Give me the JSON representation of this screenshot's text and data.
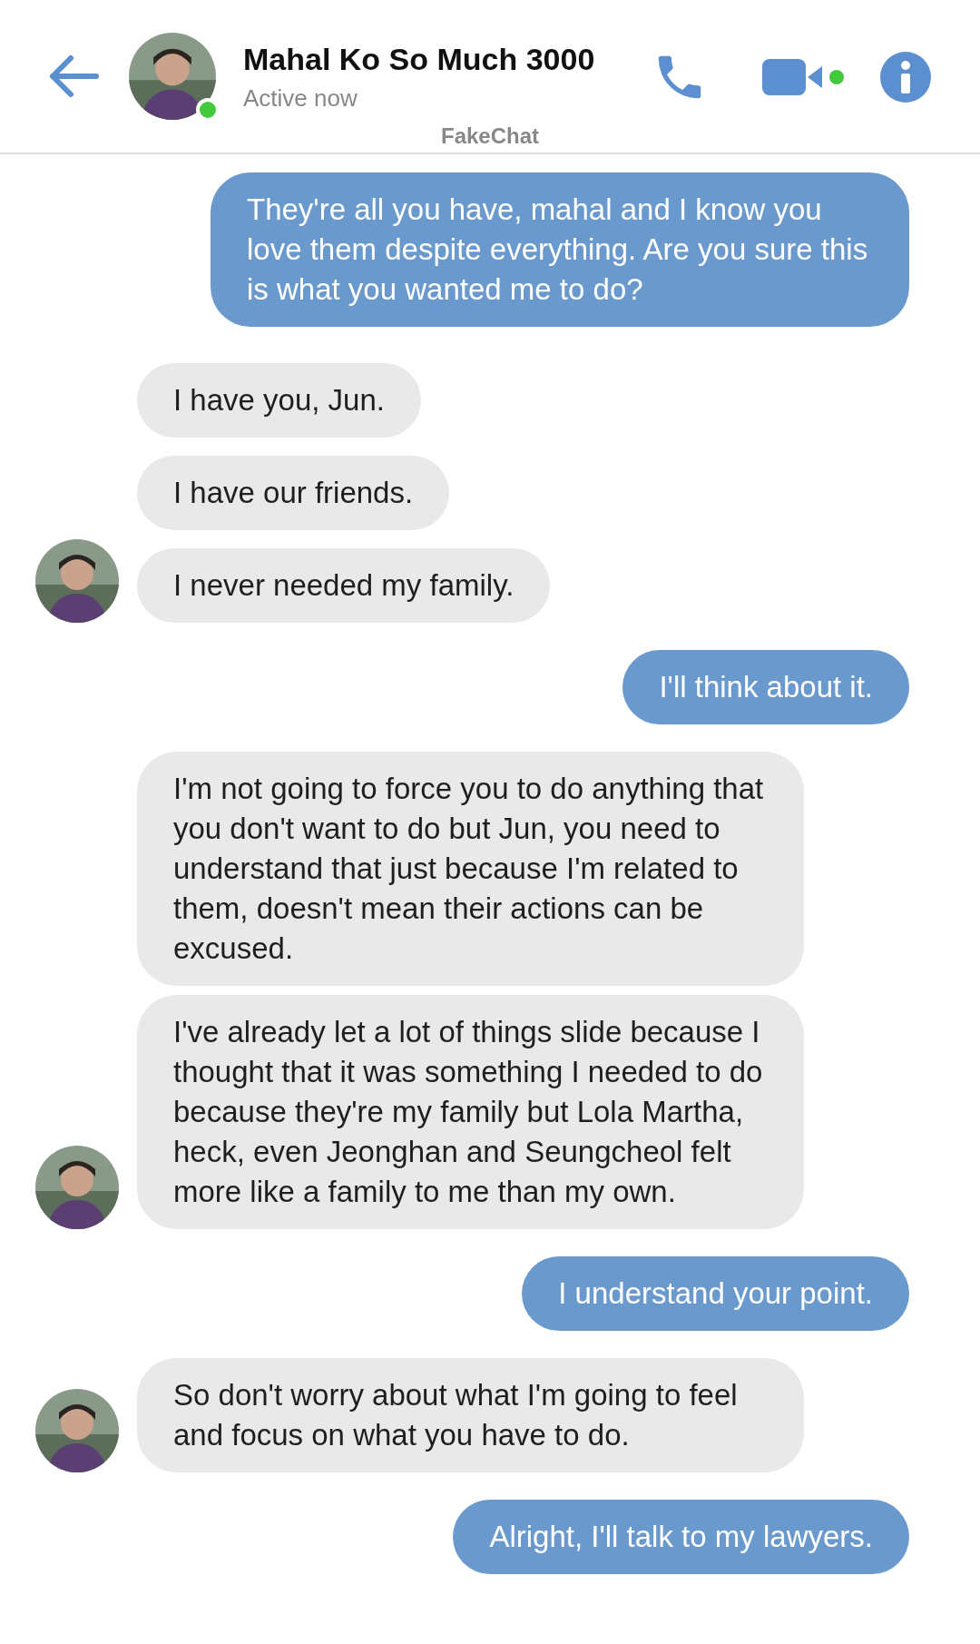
{
  "header": {
    "title": "Mahal Ko So Much 3000",
    "status": "Active now",
    "online": true,
    "app_label": "FakeChat"
  },
  "messages": [
    {
      "kind": "sent",
      "text": "They're all you have, mahal and I know you love them despite everything. Are you sure this is what you wanted me to do?"
    },
    {
      "kind": "received",
      "text": "I have you, Jun."
    },
    {
      "kind": "received",
      "text": "I have our friends."
    },
    {
      "kind": "received",
      "text": "I never needed my family."
    },
    {
      "kind": "sent",
      "text": "I'll think about it."
    },
    {
      "kind": "received",
      "text": "I'm not going to force you to do anything that you don't want to do but Jun, you need to understand that just because I'm related to them, doesn't mean their actions can be excused."
    },
    {
      "kind": "received",
      "text": "I've already let a lot of things slide because I thought that it was something I needed to do because they're my family but Lola Martha, heck, even Jeonghan and Seungcheol felt more like a family to me than my own."
    },
    {
      "kind": "sent",
      "text": "I understand your point."
    },
    {
      "kind": "received",
      "text": "So don't worry about what I'm going to feel and focus on what you have to do."
    },
    {
      "kind": "sent",
      "text": "Alright, I'll talk to my lawyers."
    }
  ]
}
